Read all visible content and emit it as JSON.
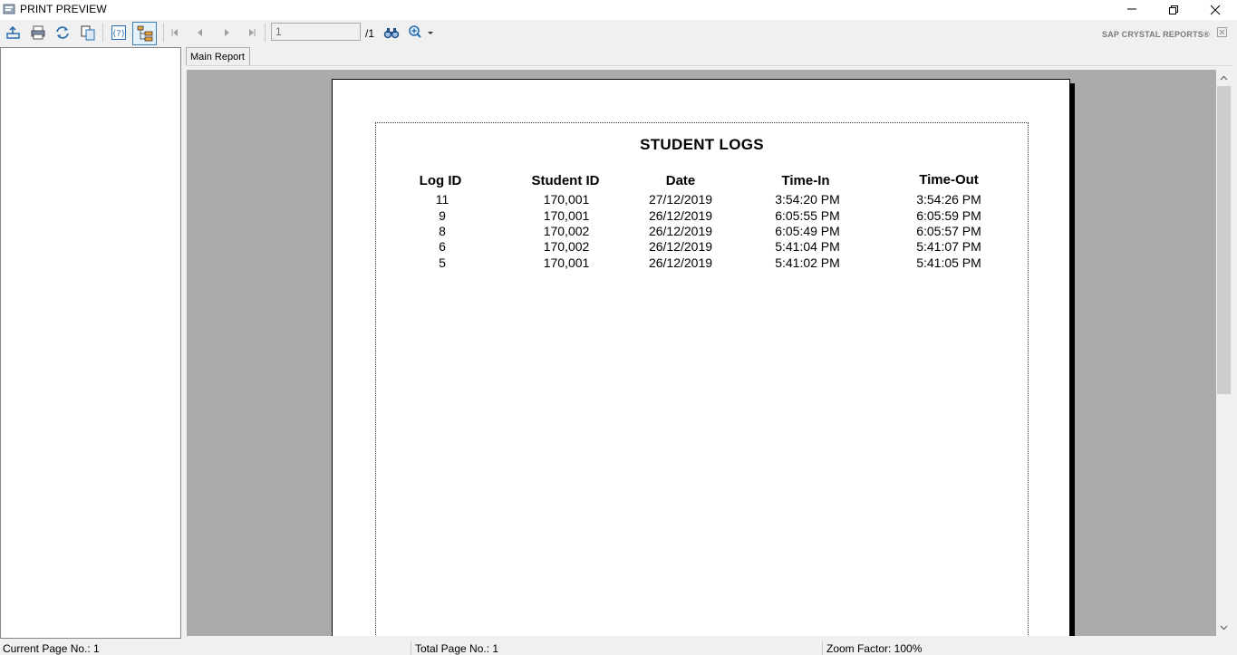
{
  "window": {
    "title": "PRINT PREVIEW",
    "icon": "crystal-reports-app-icon",
    "controls": [
      "minimize-icon",
      "restore-icon",
      "close-icon"
    ]
  },
  "toolbar": {
    "buttons": [
      "export-icon",
      "print-icon",
      "refresh-icon",
      "copy-icon",
      "help-icon",
      "group-tree-toggle-icon",
      "first-page-icon",
      "previous-page-icon",
      "next-page-icon",
      "last-page-icon",
      "find-icon",
      "zoom-icon"
    ],
    "page_input_value": "1",
    "page_total": "/1",
    "brand": "SAP CRYSTAL REPORTS®"
  },
  "tabs": {
    "main_report": "Main Report"
  },
  "report": {
    "title": "STUDENT LOGS",
    "columns": [
      "Log ID",
      "Student ID",
      "Date",
      "Time-In",
      "Time-Out"
    ],
    "rows": [
      [
        "11",
        "170,001",
        "27/12/2019",
        "3:54:20 PM",
        "3:54:26 PM"
      ],
      [
        "9",
        "170,001",
        "26/12/2019",
        "6:05:55 PM",
        "6:05:59 PM"
      ],
      [
        "8",
        "170,002",
        "26/12/2019",
        "6:05:49 PM",
        "6:05:57 PM"
      ],
      [
        "6",
        "170,002",
        "26/12/2019",
        "5:41:04 PM",
        "5:41:07 PM"
      ],
      [
        "5",
        "170,001",
        "26/12/2019",
        "5:41:02 PM",
        "5:41:05 PM"
      ]
    ]
  },
  "status": {
    "current_page": "Current Page No.: 1",
    "total_page": "Total Page No.: 1",
    "zoom": "Zoom Factor: 100%"
  },
  "colors": {
    "viewer_background": "#ababab",
    "selected_button_border": "#3c7fb1",
    "toolbar_icon_blue": "#2a6fb0"
  }
}
